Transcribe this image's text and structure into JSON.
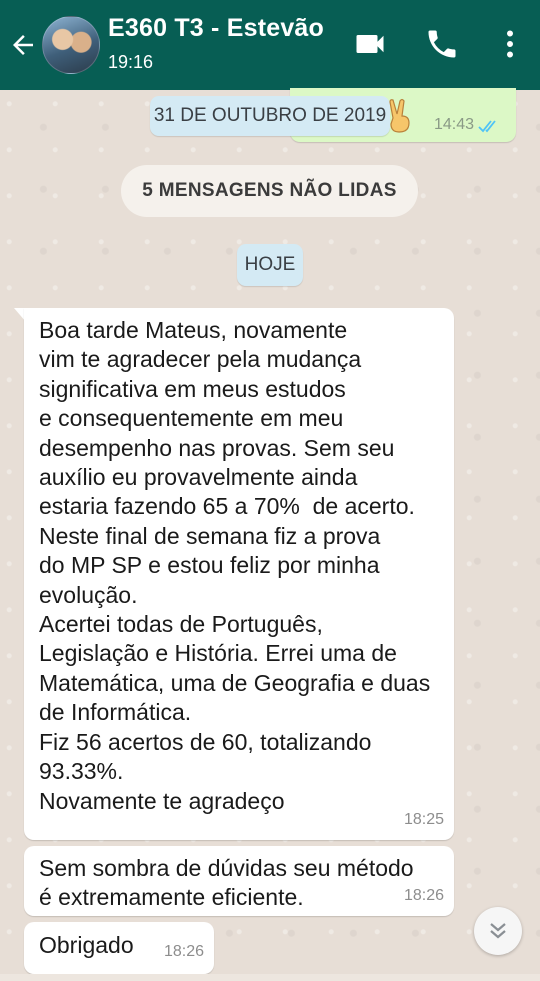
{
  "header": {
    "contact_name": "E360 T3 - Estevão",
    "status": "19:16",
    "icons": [
      "back-arrow-icon",
      "avatar",
      "video-call-icon",
      "voice-call-icon",
      "more-options-icon"
    ],
    "color": "#075e54"
  },
  "outgoing_preview": {
    "time": "14:43",
    "status": "read",
    "emoji": "victory-hand",
    "color": "#dcf8c6"
  },
  "date_separators": {
    "previous": "31 DE OUTUBRO DE 2019",
    "today": "HOJE"
  },
  "unread_banner": "5 MENSAGENS NÃO LIDAS",
  "messages": [
    {
      "text": "Boa tarde Mateus, novamente\nvim te agradecer pela mudança\nsignificativa em meus estudos\ne consequentemente em meu\ndesempenho nas provas. Sem seu\nauxílio eu provavelmente ainda\nestaria fazendo 65 a 70%  de acerto.\nNeste final de semana fiz a prova\ndo MP SP e estou feliz por minha\nevolução.\nAcertei todas de Português,\nLegislação e História. Errei uma de\nMatemática, uma de Geografia e duas\nde Informática.\nFiz 56 acertos de 60, totalizando\n93.33%.\nNovamente te agradeço",
      "time": "18:25"
    },
    {
      "text": "Sem sombra de dúvidas seu método\né extremamente eficiente.",
      "time": "18:26"
    },
    {
      "text": "Obrigado",
      "time": "18:26"
    }
  ],
  "scroll_button": "double-chevron-down-icon"
}
